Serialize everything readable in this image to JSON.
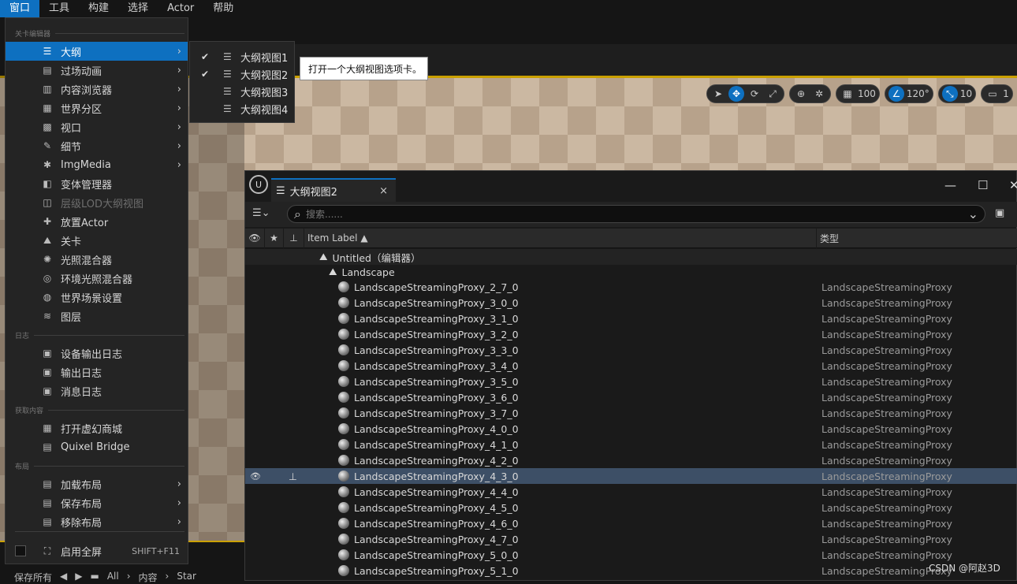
{
  "menubar": [
    "窗口",
    "工具",
    "构建",
    "选择",
    "Actor",
    "帮助"
  ],
  "window_menu": {
    "sections": {
      "level_editor": "关卡编辑器",
      "log": "日志",
      "get_content": "获取内容",
      "layout": "布局"
    },
    "items": [
      {
        "label": "大纲",
        "icon": "outliner-icon",
        "arrow": true,
        "highlight": true
      },
      {
        "label": "过场动画",
        "icon": "cinematics-icon",
        "arrow": true
      },
      {
        "label": "内容浏览器",
        "icon": "content-browser-icon",
        "arrow": true
      },
      {
        "label": "世界分区",
        "icon": "world-partition-icon",
        "arrow": true
      },
      {
        "label": "视口",
        "icon": "viewport-icon",
        "arrow": true
      },
      {
        "label": "细节",
        "icon": "details-icon",
        "arrow": true
      },
      {
        "label": "ImgMedia",
        "icon": "imgmedia-icon",
        "arrow": true
      },
      {
        "label": "变体管理器",
        "icon": "variant-icon",
        "arrow": false
      },
      {
        "label": "层级LOD大纲视图",
        "icon": "hlod-icon",
        "arrow": false,
        "disabled": true
      },
      {
        "label": "放置Actor",
        "icon": "place-actor-icon",
        "arrow": false
      },
      {
        "label": "关卡",
        "icon": "levels-icon",
        "arrow": false
      },
      {
        "label": "光照混合器",
        "icon": "light-mixer-icon",
        "arrow": false
      },
      {
        "label": "环境光照混合器",
        "icon": "env-light-mixer-icon",
        "arrow": false
      },
      {
        "label": "世界场景设置",
        "icon": "world-settings-icon",
        "arrow": false
      },
      {
        "label": "图层",
        "icon": "layers-icon",
        "arrow": false
      }
    ],
    "log_items": [
      {
        "label": "设备输出日志",
        "icon": "device-log-icon"
      },
      {
        "label": "输出日志",
        "icon": "output-log-icon"
      },
      {
        "label": "消息日志",
        "icon": "message-log-icon"
      }
    ],
    "content_items": [
      {
        "label": "打开虚幻商城",
        "icon": "marketplace-icon"
      },
      {
        "label": "Quixel Bridge",
        "icon": "bridge-icon"
      }
    ],
    "layout_items": [
      {
        "label": "加载布局",
        "icon": "load-layout-icon"
      },
      {
        "label": "保存布局",
        "icon": "save-layout-icon"
      },
      {
        "label": "移除布局",
        "icon": "remove-layout-icon"
      }
    ],
    "fullscreen": {
      "label": "启用全屏",
      "shortcut": "SHIFT+F11"
    }
  },
  "submenu": [
    {
      "label": "大纲视图1",
      "checked": true
    },
    {
      "label": "大纲视图2",
      "checked": true
    },
    {
      "label": "大纲视图3",
      "checked": false
    },
    {
      "label": "大纲视图4",
      "checked": false
    }
  ],
  "tooltip": "打开一个大纲视图选项卡。",
  "viewport_tools": {
    "grid": "100",
    "angle": "120°",
    "scale": "10",
    "camera": "1"
  },
  "outliner": {
    "tab_title": "大纲视图2",
    "tab_close": "×",
    "search_placeholder": "搜索......",
    "col_label": "Item Label ▲",
    "col_type": "类型",
    "world_row": "Untitled（编辑器）",
    "landscape_row": "Landscape",
    "type_value": "LandscapeStreamingProxy",
    "rows": [
      "LandscapeStreamingProxy_2_7_0",
      "LandscapeStreamingProxy_3_0_0",
      "LandscapeStreamingProxy_3_1_0",
      "LandscapeStreamingProxy_3_2_0",
      "LandscapeStreamingProxy_3_3_0",
      "LandscapeStreamingProxy_3_4_0",
      "LandscapeStreamingProxy_3_5_0",
      "LandscapeStreamingProxy_3_6_0",
      "LandscapeStreamingProxy_3_7_0",
      "LandscapeStreamingProxy_4_0_0",
      "LandscapeStreamingProxy_4_1_0",
      "LandscapeStreamingProxy_4_2_0",
      "LandscapeStreamingProxy_4_3_0",
      "LandscapeStreamingProxy_4_4_0",
      "LandscapeStreamingProxy_4_5_0",
      "LandscapeStreamingProxy_4_6_0",
      "LandscapeStreamingProxy_4_7_0",
      "LandscapeStreamingProxy_5_0_0",
      "LandscapeStreamingProxy_5_1_0"
    ],
    "selected_row": "LandscapeStreamingProxy_4_3_0"
  },
  "bottom": {
    "save_all": "保存所有",
    "all": "All",
    "content": "内容",
    "star": "Star"
  },
  "watermark": "CSDN @阿赵3D",
  "colors": {
    "accent": "#0e70c0",
    "selection": "#3d4f66",
    "highlight_border": "#caa000"
  }
}
